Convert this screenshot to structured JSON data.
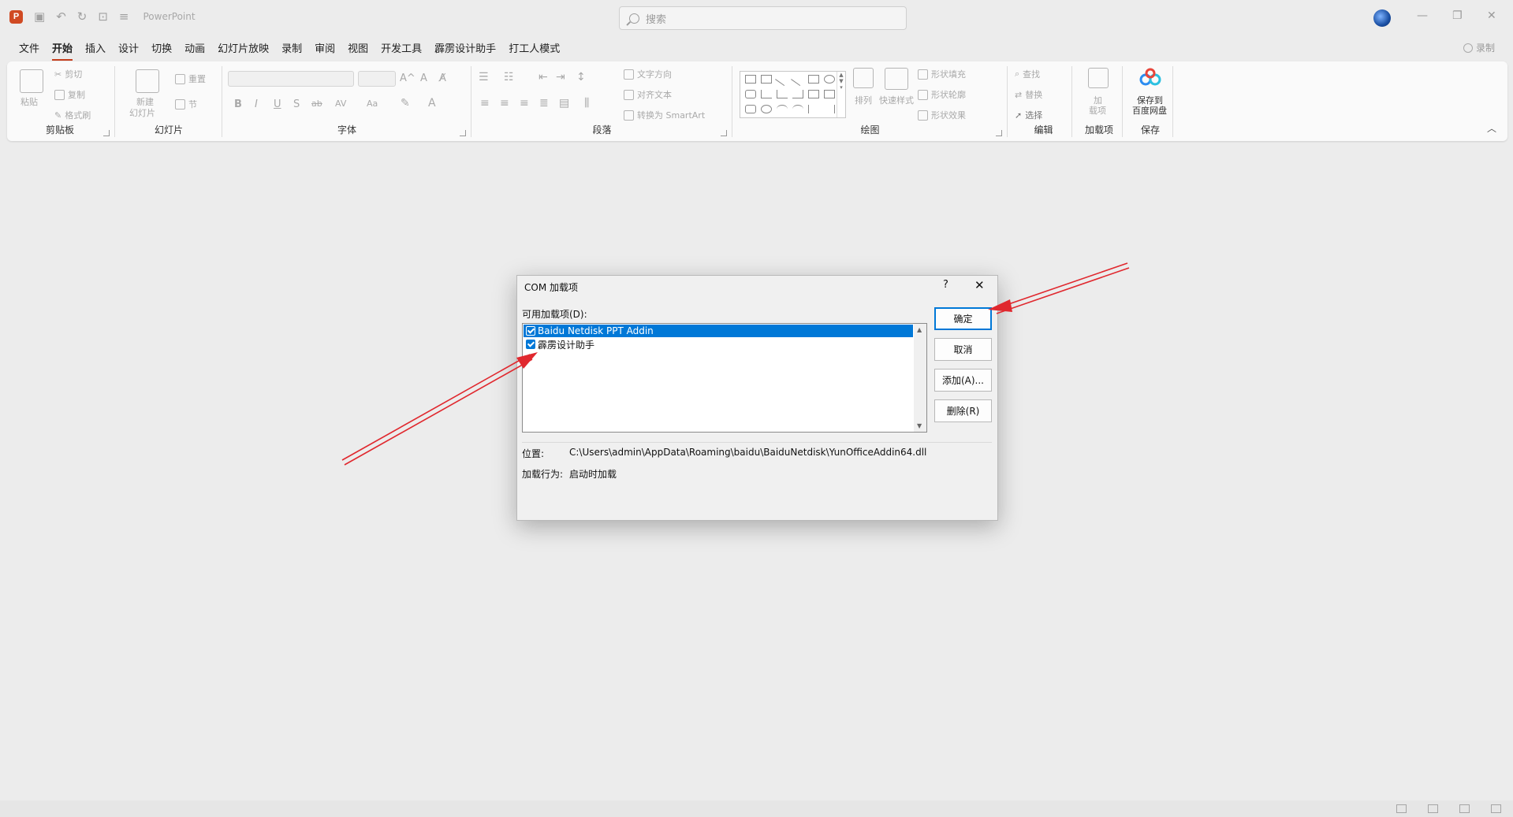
{
  "titlebar": {
    "logo": "P",
    "app_name": "PowerPoint",
    "search_placeholder": "搜索",
    "icons": [
      "save-icon",
      "undo-icon",
      "redo-icon",
      "present-icon",
      "customize-icon"
    ],
    "controls": [
      "minimize",
      "restore",
      "close"
    ]
  },
  "tabs": [
    "文件",
    "开始",
    "插入",
    "设计",
    "切换",
    "动画",
    "幻灯片放映",
    "录制",
    "审阅",
    "视图",
    "开发工具",
    "霹雳设计助手",
    "打工人模式"
  ],
  "active_tab": "开始",
  "record_label": "录制",
  "ribbon": {
    "clipboard": {
      "label": "剪贴板",
      "paste": "粘贴",
      "cut": "剪切",
      "copy": "复制",
      "format_painter": "格式刷"
    },
    "slides": {
      "label": "幻灯片",
      "new_slide_1": "新建",
      "new_slide_2": "幻灯片",
      "reset": "重置",
      "section": "节"
    },
    "font": {
      "label": "字体",
      "bold": "B",
      "italic": "I",
      "underline": "U",
      "shadow": "S",
      "strike": "ab",
      "spacing": "AV",
      "case": "Aa",
      "grow": "A^",
      "shrink": "A"
    },
    "paragraph": {
      "label": "段落",
      "text_direction": "文字方向",
      "align_text": "对齐文本",
      "smartart": "转换为 SmartArt"
    },
    "drawing": {
      "label": "绘图",
      "arrange": "排列",
      "quick_styles": "快速样式",
      "shape_fill": "形状填充",
      "shape_outline": "形状轮廓",
      "shape_effects": "形状效果"
    },
    "editing": {
      "label": "编辑",
      "find": "查找",
      "replace": "替换",
      "select": "选择"
    },
    "addins": {
      "label": "加载项",
      "addins_btn_1": "加",
      "addins_btn_2": "载项"
    },
    "save": {
      "label": "保存",
      "save_to_1": "保存到",
      "save_to_2": "百度网盘"
    }
  },
  "dialog": {
    "title": "COM 加载项",
    "help": "?",
    "close": "✕",
    "available_label": "可用加载项(D):",
    "items": [
      {
        "name": "Baidu Netdisk PPT Addin",
        "checked": true,
        "selected": true
      },
      {
        "name": "霹雳设计助手",
        "checked": true,
        "selected": false
      }
    ],
    "buttons": {
      "ok": "确定",
      "cancel": "取消",
      "add": "添加(A)...",
      "remove": "删除(R)"
    },
    "location_label": "位置:",
    "location_value": "C:\\Users\\admin\\AppData\\Roaming\\baidu\\BaiduNetdisk\\YunOfficeAddin64.dll",
    "load_behavior_label": "加载行为:",
    "load_behavior_value": "启动时加载"
  },
  "colors": {
    "accent": "#c43e1c",
    "selection": "#0078d7",
    "annotation": "#e0282e"
  }
}
